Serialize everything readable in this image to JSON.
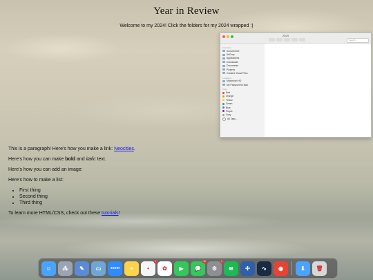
{
  "page": {
    "title": "Year in Review",
    "welcome": "Welcome to my 2024! Click the folders for my 2024 wrapped :)"
  },
  "finder": {
    "window_title": "2024",
    "search_placeholder": "Search",
    "sections": {
      "favorites": "Favorites",
      "locations": "Locations",
      "tags": "Tags"
    },
    "favorites": [
      "iCloud Drive",
      "AirDrop",
      "Applications",
      "Downloads",
      "Documents",
      "Pictures",
      "Creative Cloud Files"
    ],
    "locations": [
      "Macintosh HD",
      "My Passport for Mac"
    ],
    "tags": [
      {
        "label": "Red",
        "color": "#f44336"
      },
      {
        "label": "Orange",
        "color": "#ff9800"
      },
      {
        "label": "Yellow",
        "color": "#fdd835"
      },
      {
        "label": "Green",
        "color": "#43a047"
      },
      {
        "label": "Blue",
        "color": "#1e88e5"
      },
      {
        "label": "Purple",
        "color": "#8e24aa"
      },
      {
        "label": "Gray",
        "color": "#9e9e9e"
      },
      {
        "label": "All Tags...",
        "color": ""
      }
    ]
  },
  "content": {
    "p1_text": "This is a paragraph! Here's how you make a link: ",
    "p1_link": "Neocities",
    "p1_end": ".",
    "p2_a": "Here's how you can make ",
    "p2_bold": "bold",
    "p2_b": " and ",
    "p2_italic": "italic",
    "p2_c": " text.",
    "p3": "Here's how you can add an image:",
    "p4": "Here's how to make a list:",
    "list": [
      "First thing",
      "Second thing",
      "Third thing"
    ],
    "p5_a": "To learn more HTML/CSS, check out these ",
    "p5_link": "tutorials",
    "p5_b": "!"
  },
  "dock": {
    "apps": [
      {
        "name": "finder",
        "icon": "finder-icon",
        "color": "#4aa3ff",
        "glyph": "☺"
      },
      {
        "name": "launchpad",
        "icon": "launchpad-icon",
        "color": "#9aa4b2",
        "glyph": "⁂"
      },
      {
        "name": "xcode",
        "icon": "xcode-icon",
        "color": "#5b8bd6",
        "glyph": "✎"
      },
      {
        "name": "preview",
        "icon": "preview-icon",
        "color": "#6fa6d6",
        "glyph": "▭"
      },
      {
        "name": "zoom",
        "icon": "zoom-icon",
        "color": "#2d8cff",
        "glyph": "zoom"
      },
      {
        "name": "notes",
        "icon": "notes-icon",
        "color": "#fbd34d",
        "glyph": "≡"
      },
      {
        "name": "reminders",
        "icon": "reminders-icon",
        "color": "#f5f5f5",
        "glyph": "•",
        "badge": "1"
      },
      {
        "name": "photos",
        "icon": "photos-icon",
        "color": "#ffffff",
        "glyph": "✿"
      },
      {
        "name": "facetime",
        "icon": "facetime-icon",
        "color": "#34c759",
        "glyph": "▶"
      },
      {
        "name": "messages",
        "icon": "messages-icon",
        "color": "#34c759",
        "glyph": "💬",
        "badge": "12"
      },
      {
        "name": "system-preferences",
        "icon": "settings-icon",
        "color": "#8e8e93",
        "glyph": "⚙",
        "badge": "1"
      },
      {
        "name": "spotify",
        "icon": "spotify-icon",
        "color": "#1db954",
        "glyph": "≋"
      },
      {
        "name": "vpn",
        "icon": "vpn-icon",
        "color": "#2f5fa8",
        "glyph": "✣"
      },
      {
        "name": "activity-monitor",
        "icon": "activity-icon",
        "color": "#1a2a44",
        "glyph": "∿"
      },
      {
        "name": "chrome",
        "icon": "chrome-icon",
        "color": "#e94235",
        "glyph": "◉"
      },
      {
        "name": "downloads",
        "icon": "downloads-icon",
        "color": "#4aa3ff",
        "glyph": "⬇"
      },
      {
        "name": "trash",
        "icon": "trash-icon",
        "color": "#d8d8d8",
        "glyph": "🗑"
      }
    ]
  }
}
